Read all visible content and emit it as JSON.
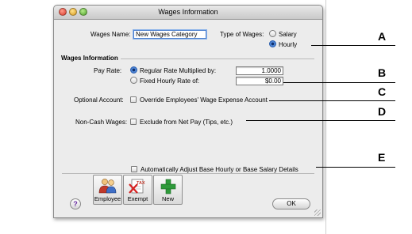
{
  "window": {
    "title": "Wages Information"
  },
  "wages_name": {
    "label": "Wages Name:",
    "value": "New Wages Category"
  },
  "type_of_wages": {
    "label": "Type of Wages:",
    "options": [
      {
        "label": "Salary",
        "selected": false
      },
      {
        "label": "Hourly",
        "selected": true
      }
    ]
  },
  "wages_info": {
    "heading": "Wages Information",
    "pay_rate_label": "Pay Rate:",
    "regular_rate": {
      "label": "Regular Rate Multiplied by:",
      "value": "1.0000",
      "selected": true
    },
    "fixed_rate": {
      "label": "Fixed Hourly Rate of:",
      "value": "$0.00",
      "selected": false
    }
  },
  "optional_account": {
    "label": "Optional Account:",
    "checkbox_label": "Override Employees' Wage Expense Account",
    "checked": false
  },
  "non_cash": {
    "label": "Non-Cash Wages:",
    "checkbox_label": "Exclude from Net Pay (Tips, etc.)",
    "checked": false
  },
  "auto_adjust": {
    "checkbox_label": "Automatically Adjust Base Hourly or Base Salary Details",
    "checked": false
  },
  "toolbar": {
    "employee_label": "Employee",
    "exempt_label": "Exempt",
    "new_label": "New",
    "tax_text": "TAX"
  },
  "help_label": "?",
  "ok_label": "OK",
  "callouts": [
    "A",
    "B",
    "C",
    "D",
    "E"
  ]
}
